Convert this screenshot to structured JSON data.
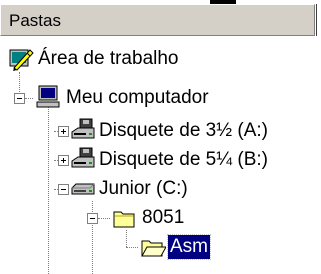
{
  "panel": {
    "title": "Pastas"
  },
  "tree": {
    "items": [
      {
        "label": "Área de trabalho",
        "icon": "desktop-pen-icon",
        "expanded": true
      },
      {
        "label": "Meu computador",
        "icon": "computer-icon",
        "expanded": true
      },
      {
        "label": "Disquete de 3½ (A:)",
        "icon": "floppy-drive-icon",
        "expanded": false
      },
      {
        "label": "Disquete de 5¼ (B:)",
        "icon": "floppy-drive-icon",
        "expanded": false
      },
      {
        "label": "Junior (C:)",
        "icon": "hard-drive-icon",
        "expanded": true
      },
      {
        "label": "8051",
        "icon": "folder-icon",
        "expanded": true
      },
      {
        "label": "Asm",
        "icon": "open-folder-icon",
        "selected": true
      }
    ]
  },
  "colors": {
    "selection_bg": "#000080",
    "selection_fg": "#ffffff",
    "header_bg": "#d4d0c8",
    "folder_yellow": "#ffff99",
    "tree_line": "#808080"
  }
}
